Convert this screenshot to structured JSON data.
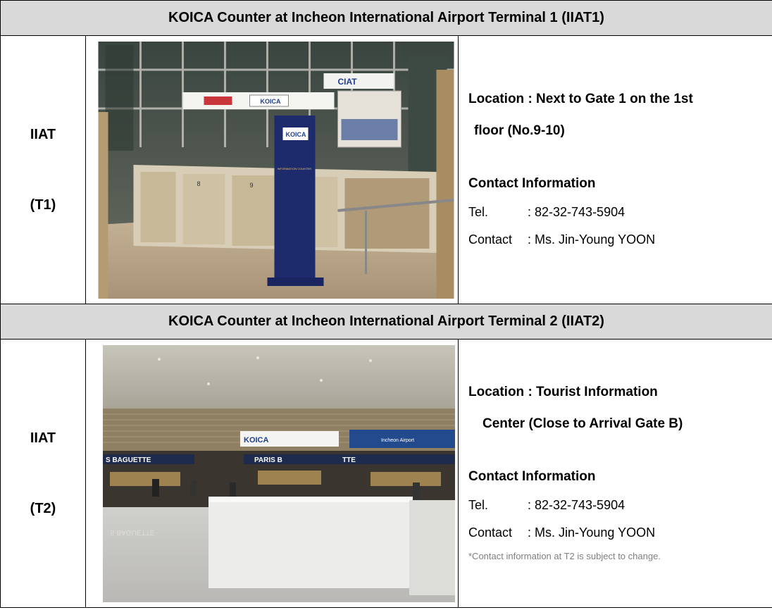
{
  "sections": [
    {
      "header": "KOICA Counter at Incheon International Airport Terminal 1 (IIAT1)",
      "label_line1": "IIAT",
      "label_line2": "(T1)",
      "location_line1": "Location : Next to Gate 1 on the 1st",
      "location_line2": "floor (No.9-10)",
      "contact_heading": "Contact Information",
      "tel_key": "Tel.",
      "tel_value": ": 82-32-743-5904",
      "contact_key": "Contact",
      "contact_value": ": Ms. Jin-Young YOON",
      "photo": {
        "counter_logo": "KOICA",
        "brand_logo": "KOICA",
        "sign_banner": "CIAT",
        "counter_numbers": [
          "8",
          "9",
          "10"
        ],
        "stand_text": [
          "INFORMATION COUNTER"
        ]
      }
    },
    {
      "header": "KOICA Counter at Incheon International Airport Terminal 2 (IIAT2)",
      "label_line1": "IIAT",
      "label_line2": "(T2)",
      "location_line1": "Location : Tourist Information",
      "location_line2": "Center (Close to Arrival Gate B)",
      "contact_heading": "Contact Information",
      "tel_key": "Tel.",
      "tel_value": ": 82-32-743-5904",
      "contact_key": "Contact",
      "contact_value": ": Ms. Jin-Young YOON",
      "note": "*Contact information at T2 is subject to change.",
      "photo": {
        "shop_sign_left": "S BAGUETTE",
        "shop_sign_center": "PARIS B",
        "shop_sign_center2": "TTE",
        "koica_sign": "KOICA",
        "airport_sign": "Incheon Airport",
        "floor_reflection": "S BAGUETTE"
      }
    }
  ]
}
